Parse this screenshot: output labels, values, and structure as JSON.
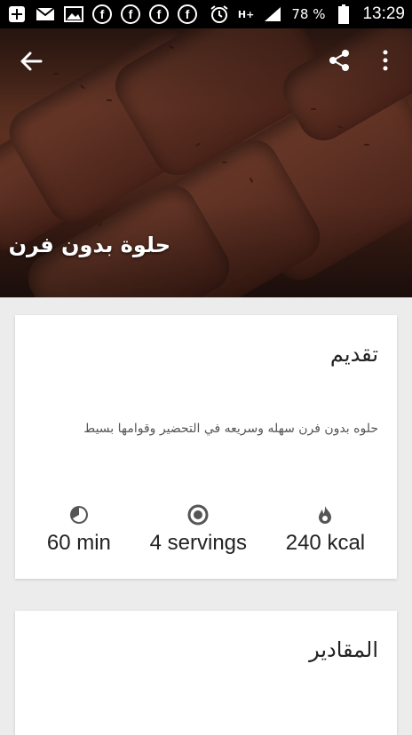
{
  "status_bar": {
    "battery": "78 %",
    "time": "13:29",
    "network": "H+"
  },
  "recipe": {
    "title": "حلوة بدون فرن"
  },
  "intro": {
    "heading": "تقديم",
    "description": "حلوه بدون فرن سهله وسريعه في التحضير وقوامها بسيط",
    "stats": {
      "time": "60 min",
      "servings": "4 servings",
      "calories": "240 kcal"
    }
  },
  "ingredients": {
    "heading": "المقادير"
  }
}
